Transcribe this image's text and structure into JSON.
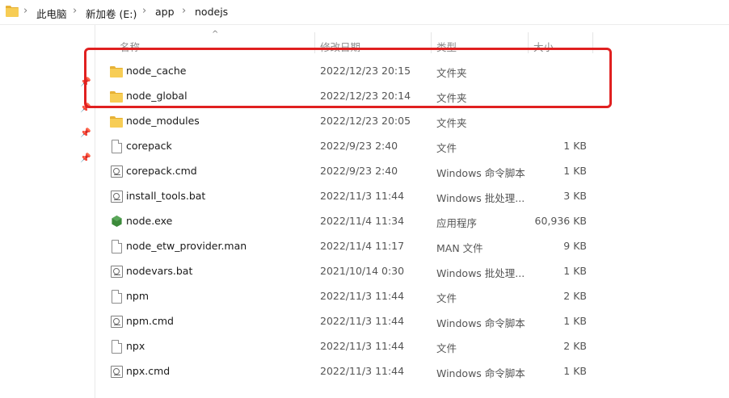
{
  "breadcrumb": {
    "items": [
      "此电脑",
      "新加卷 (E:)",
      "app",
      "nodejs"
    ],
    "separator": "›"
  },
  "columns": {
    "name": "名称",
    "date": "修改日期",
    "type": "类型",
    "size": "大小"
  },
  "files": [
    {
      "name": "node_cache",
      "date": "2022/12/23 20:15",
      "type": "文件夹",
      "size": "",
      "icon": "folder-icon"
    },
    {
      "name": "node_global",
      "date": "2022/12/23 20:14",
      "type": "文件夹",
      "size": "",
      "icon": "folder-icon"
    },
    {
      "name": "node_modules",
      "date": "2022/12/23 20:05",
      "type": "文件夹",
      "size": "",
      "icon": "folder-icon"
    },
    {
      "name": "corepack",
      "date": "2022/9/23 2:40",
      "type": "文件",
      "size": "1 KB",
      "icon": "file-icon"
    },
    {
      "name": "corepack.cmd",
      "date": "2022/9/23 2:40",
      "type": "Windows 命令脚本",
      "size": "1 KB",
      "icon": "script-icon"
    },
    {
      "name": "install_tools.bat",
      "date": "2022/11/3 11:44",
      "type": "Windows 批处理...",
      "size": "3 KB",
      "icon": "script-icon"
    },
    {
      "name": "node.exe",
      "date": "2022/11/4 11:34",
      "type": "应用程序",
      "size": "60,936 KB",
      "icon": "node-exe-icon"
    },
    {
      "name": "node_etw_provider.man",
      "date": "2022/11/4 11:17",
      "type": "MAN 文件",
      "size": "9 KB",
      "icon": "file-icon"
    },
    {
      "name": "nodevars.bat",
      "date": "2021/10/14 0:30",
      "type": "Windows 批处理...",
      "size": "1 KB",
      "icon": "script-icon"
    },
    {
      "name": "npm",
      "date": "2022/11/3 11:44",
      "type": "文件",
      "size": "2 KB",
      "icon": "file-icon"
    },
    {
      "name": "npm.cmd",
      "date": "2022/11/3 11:44",
      "type": "Windows 命令脚本",
      "size": "1 KB",
      "icon": "script-icon"
    },
    {
      "name": "npx",
      "date": "2022/11/3 11:44",
      "type": "文件",
      "size": "2 KB",
      "icon": "file-icon"
    },
    {
      "name": "npx.cmd",
      "date": "2022/11/3 11:44",
      "type": "Windows 命令脚本",
      "size": "1 KB",
      "icon": "script-icon"
    }
  ],
  "colors": {
    "highlight": "#e02020",
    "folder": "#f7cd55",
    "node_green": "#3c8a3a"
  }
}
